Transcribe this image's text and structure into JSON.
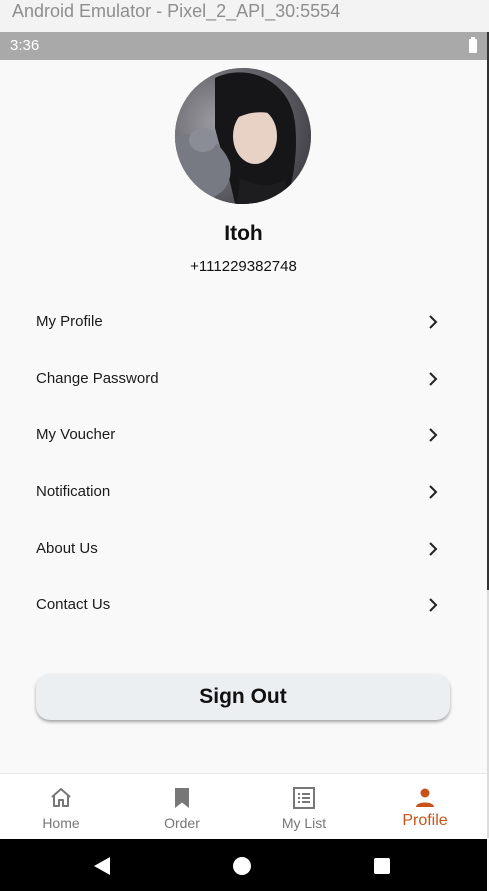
{
  "window": {
    "title": "Android Emulator - Pixel_2_API_30:5554"
  },
  "status_bar": {
    "time": "3:36"
  },
  "profile": {
    "name": "Itoh",
    "phone": "+111229382748"
  },
  "menu": [
    {
      "label": "My Profile"
    },
    {
      "label": "Change Password"
    },
    {
      "label": "My Voucher"
    },
    {
      "label": "Notification"
    },
    {
      "label": "About Us"
    },
    {
      "label": "Contact Us"
    }
  ],
  "sign_out_label": "Sign Out",
  "bottom_nav": [
    {
      "label": "Home",
      "icon": "home-icon",
      "active": false
    },
    {
      "label": "Order",
      "icon": "bookmark-icon",
      "active": false
    },
    {
      "label": "My List",
      "icon": "list-icon",
      "active": false
    },
    {
      "label": "Profile",
      "icon": "person-icon",
      "active": true
    }
  ],
  "colors": {
    "accent": "#c8531a",
    "inactive": "#777777",
    "button_bg": "#eceff1"
  }
}
